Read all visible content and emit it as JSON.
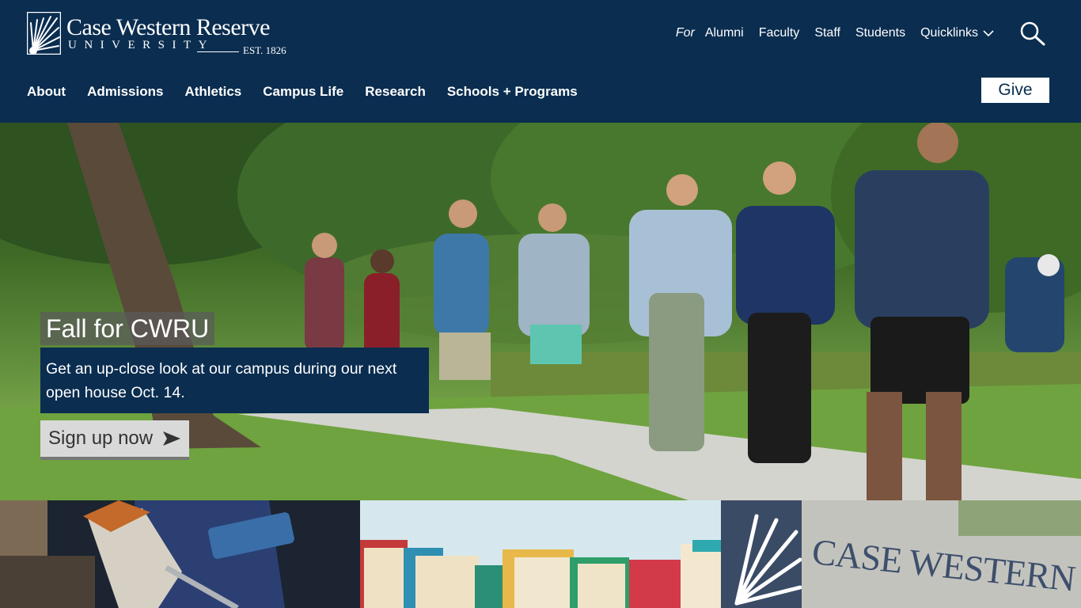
{
  "brand": {
    "name": "Case Western Reserve",
    "sub": "UNIVERSITY",
    "est": "EST. 1826",
    "colors": {
      "navy": "#0a2d50",
      "white": "#ffffff",
      "button_gray": "#d9d9d9"
    }
  },
  "audience_nav": {
    "for_label": "For",
    "items": [
      "Alumni",
      "Faculty",
      "Staff",
      "Students"
    ],
    "quicklinks_label": "Quicklinks"
  },
  "main_nav": {
    "items": [
      "About",
      "Admissions",
      "Athletics",
      "Campus Life",
      "Research",
      "Schools + Programs"
    ]
  },
  "give_label": "Give",
  "hero": {
    "title": "Fall for CWRU",
    "body": "Get an up-close look at our campus during our next open house Oct. 14.",
    "cta_label": "Sign up now"
  },
  "tiles": {
    "tile3_text": "CASE WESTERN RESERVE"
  },
  "icons": {
    "search": "search-icon",
    "chevron": "chevron-down-icon",
    "arrow": "arrow-right-icon",
    "logo": "sunburst-logo-icon"
  }
}
